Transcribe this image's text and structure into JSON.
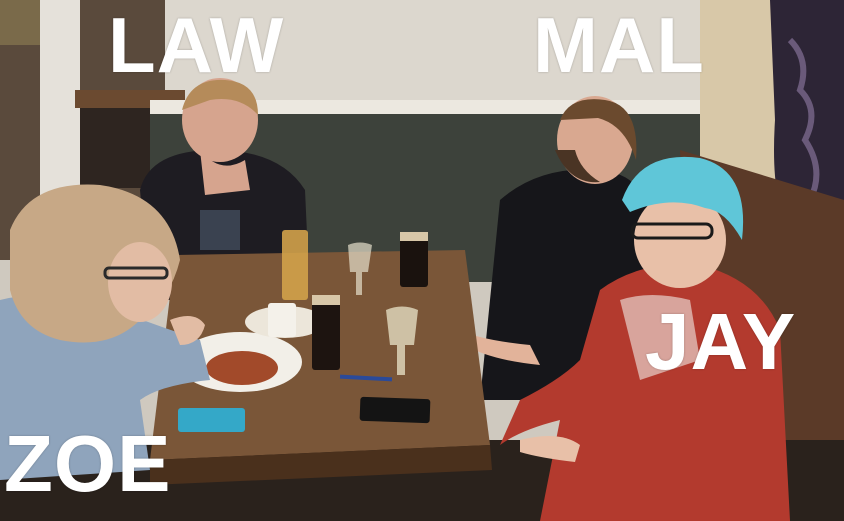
{
  "labels": {
    "law": "LAW",
    "mal": "MAL",
    "jay": "JAY",
    "zoe": "ZOE"
  },
  "colors": {
    "label_text": "#ffffff",
    "wall": "#d7d2c9",
    "wall_panel": "#3e433c",
    "table": "#7a5638",
    "hair_blue": "#5fc6d8"
  }
}
